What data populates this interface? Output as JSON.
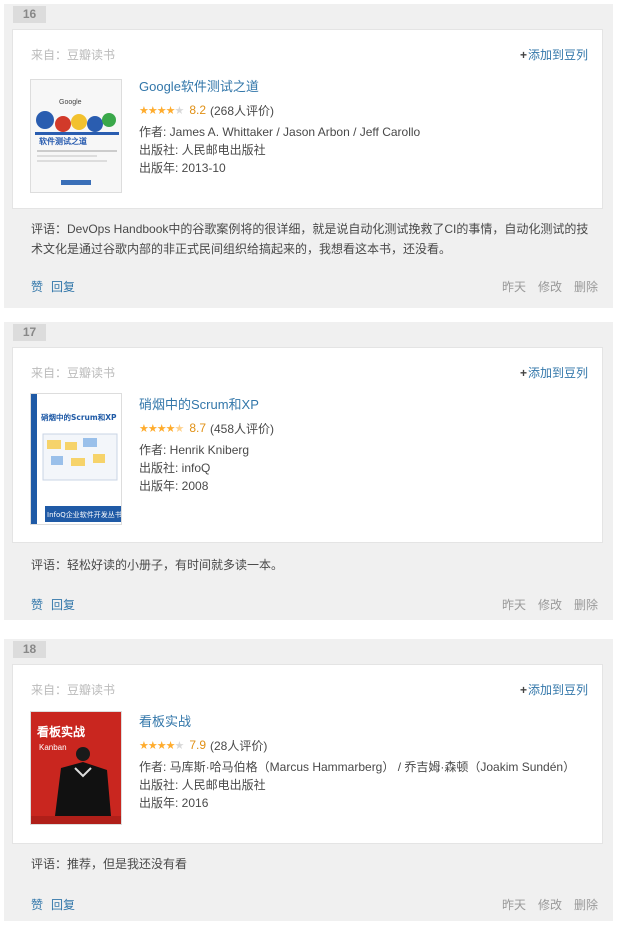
{
  "items": [
    {
      "index": "16",
      "source_label": "来自：豆瓣读书",
      "add_label": "添加到豆列",
      "title": "Google软件测试之道",
      "stars": 4,
      "score": "8.2",
      "votes": "(268人评价)",
      "author": "作者: James A. Whittaker / Jason Arbon / Jeff Carollo",
      "publisher": "出版社: 人民邮电出版社",
      "year": "出版年: 2013-10",
      "cover_text": [
        "Google",
        "软件测试之道"
      ],
      "comment": "评语：DevOps Handbook中的谷歌案例将的很详细，就是说自动化测试挽救了CI的事情，自动化测试的技术文化是通过谷歌内部的非正式民间组织给搞起来的，我想看这本书，还没看。",
      "like": "赞",
      "reply": "回复",
      "time": "昨天",
      "edit": "修改",
      "delete": "删除"
    },
    {
      "index": "17",
      "source_label": "来自：豆瓣读书",
      "add_label": "添加到豆列",
      "title": "硝烟中的Scrum和XP",
      "stars": 4.5,
      "score": "8.7",
      "votes": "(458人评价)",
      "author": "作者: Henrik Kniberg",
      "publisher": "出版社: infoQ",
      "year": "出版年: 2008",
      "cover_text": [
        "硝烟中的Scrum和XP",
        "InfoQ企业软件开发丛书"
      ],
      "comment": "评语：轻松好读的小册子，有时间就多读一本。",
      "like": "赞",
      "reply": "回复",
      "time": "昨天",
      "edit": "修改",
      "delete": "删除"
    },
    {
      "index": "18",
      "source_label": "来自：豆瓣读书",
      "add_label": "添加到豆列",
      "title": "看板实战",
      "stars": 4,
      "score": "7.9",
      "votes": "(28人评价)",
      "author": "作者: 马库斯·哈马伯格（Marcus Hammarberg） / 乔吉姆·森顿（Joakim Sundén）",
      "publisher": "出版社: 人民邮电出版社",
      "year": "出版年: 2016",
      "cover_text": [
        "看板实战",
        "Kanban"
      ],
      "comment": "评语：推荐，但是我还没有看",
      "like": "赞",
      "reply": "回复",
      "time": "昨天",
      "edit": "修改",
      "delete": "删除"
    }
  ],
  "colors": {
    "link": "#3377aa",
    "star": "#ffac2d",
    "score": "#e09015",
    "muted": "#999999"
  }
}
